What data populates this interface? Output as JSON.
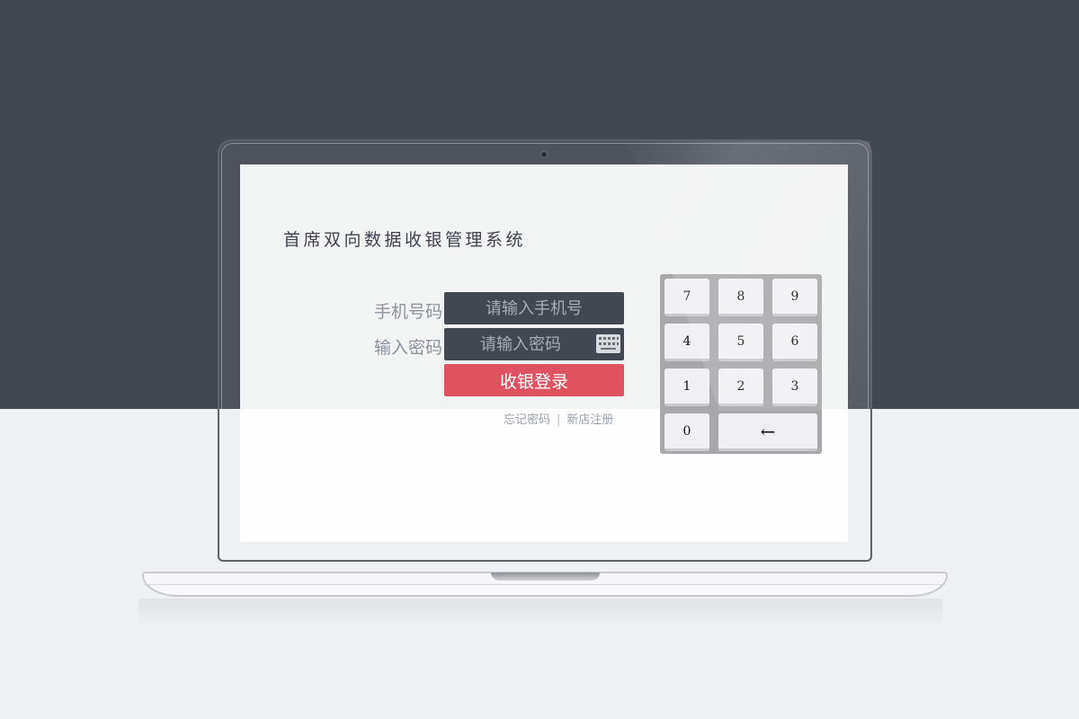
{
  "title": "首席双向数据收银管理系统",
  "form": {
    "phone_label": "手机号码",
    "phone_placeholder": "请输入手机号",
    "password_label": "输入密码",
    "password_placeholder": "请输入密码",
    "login_label": "收银登录",
    "forgot_label": "忘记密码",
    "separator": "|",
    "register_label": "新店注册"
  },
  "keypad": {
    "keys": [
      "7",
      "8",
      "9",
      "4",
      "5",
      "6",
      "1",
      "2",
      "3",
      "0"
    ],
    "backspace": "←"
  },
  "colors": {
    "dark_bg": "#424852",
    "light_bg": "#eff0f4",
    "accent": "#df5260"
  }
}
